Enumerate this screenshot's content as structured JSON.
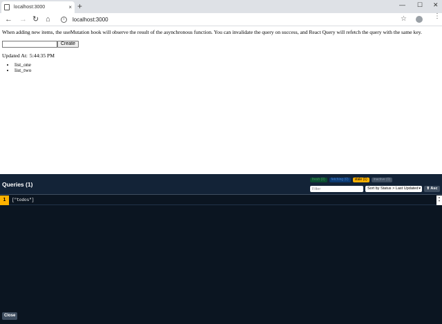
{
  "browser": {
    "tab_title": "localhost:3000",
    "tab_close": "×",
    "new_tab": "+",
    "window_controls": {
      "minimize": "—",
      "maximize": "☐",
      "close": "✕"
    },
    "nav": {
      "back": "←",
      "forward": "→",
      "reload": "↻",
      "home": "⌂"
    },
    "url": "localhost:3000",
    "info_glyph": "i",
    "star": "☆",
    "menu": "⋮"
  },
  "page": {
    "description": "When adding new items, the useMutation hook will observe the result of the asynchronous function. You can invalidate the query on success, and React Query will refetch the query with the same key.",
    "input_value": "",
    "create_label": "Create",
    "updated_label": "Updated At:",
    "updated_time": "5:44:35 PM",
    "lists": [
      "list_one",
      "list_two"
    ]
  },
  "devtools": {
    "title": "Queries (1)",
    "badges": {
      "fresh": "fresh (0)",
      "fetching": "fetching (0)",
      "stale": "stale (1)",
      "inactive": "inactive (0)"
    },
    "filter_placeholder": "Filter",
    "sort_label": "Sort by Status > Last Updated",
    "sort_caret": "▾",
    "asc_label": "⬆ Asc",
    "queries": [
      {
        "count": "1",
        "key": "[\"todos\"]"
      }
    ],
    "close_label": "Close"
  },
  "colors": {
    "devtools_bg": "#0b1521",
    "devtools_header": "#132337",
    "stale_accent": "#ffb200",
    "fresh_accent": "#0b4d2f",
    "fetching_accent": "#0b3a73",
    "inactive_accent": "#3f4e60"
  },
  "icons": {
    "page_icon": "document-icon",
    "back": "arrow-left-icon",
    "forward": "arrow-right-icon",
    "reload": "reload-icon",
    "home": "home-icon",
    "info": "info-icon",
    "bookmark": "star-icon",
    "profile": "avatar-icon",
    "menu": "more-vertical-icon"
  }
}
